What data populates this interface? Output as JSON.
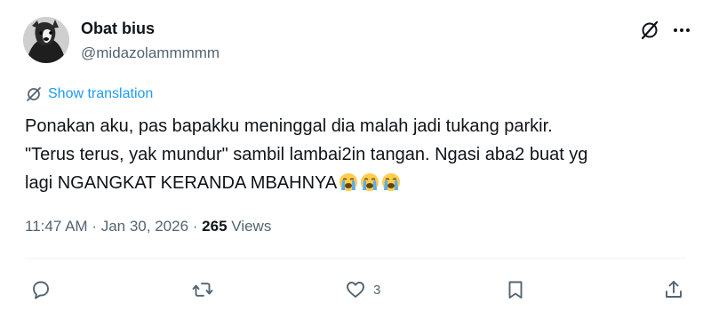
{
  "author": {
    "display_name": "Obat bius",
    "handle": "@midazolammmmm"
  },
  "header_icons": {
    "grok": "grok-icon",
    "more": "more-icon"
  },
  "translation": {
    "label": "Show translation",
    "icon": "translate-icon"
  },
  "tweet": {
    "lines": [
      "Ponakan aku, pas bapakku meninggal dia malah jadi tukang parkir.",
      "\"Terus terus, yak mundur\" sambil lambai2in tangan. Ngasi aba2 buat yg",
      "lagi NGANGKAT KERANDA MBAHNYA"
    ],
    "emojis": [
      "loudly-crying-face",
      "loudly-crying-face",
      "loudly-crying-face"
    ]
  },
  "meta": {
    "time": "11:47 AM",
    "separator": "·",
    "date": "Jan 30, 2026",
    "views_count": "265",
    "views_label": "Views"
  },
  "actions": {
    "reply": {
      "icon": "reply-icon",
      "count": ""
    },
    "retweet": {
      "icon": "retweet-icon",
      "count": ""
    },
    "like": {
      "icon": "heart-icon",
      "count": "3"
    },
    "bookmark": {
      "icon": "bookmark-icon",
      "count": ""
    },
    "share": {
      "icon": "share-icon",
      "count": ""
    }
  },
  "colors": {
    "text_primary": "#0f1419",
    "text_secondary": "#536471",
    "link": "#1d9bf0",
    "divider": "#eff3f4",
    "emoji_face": "#ffcc4d",
    "emoji_tears": "#5dadec"
  }
}
